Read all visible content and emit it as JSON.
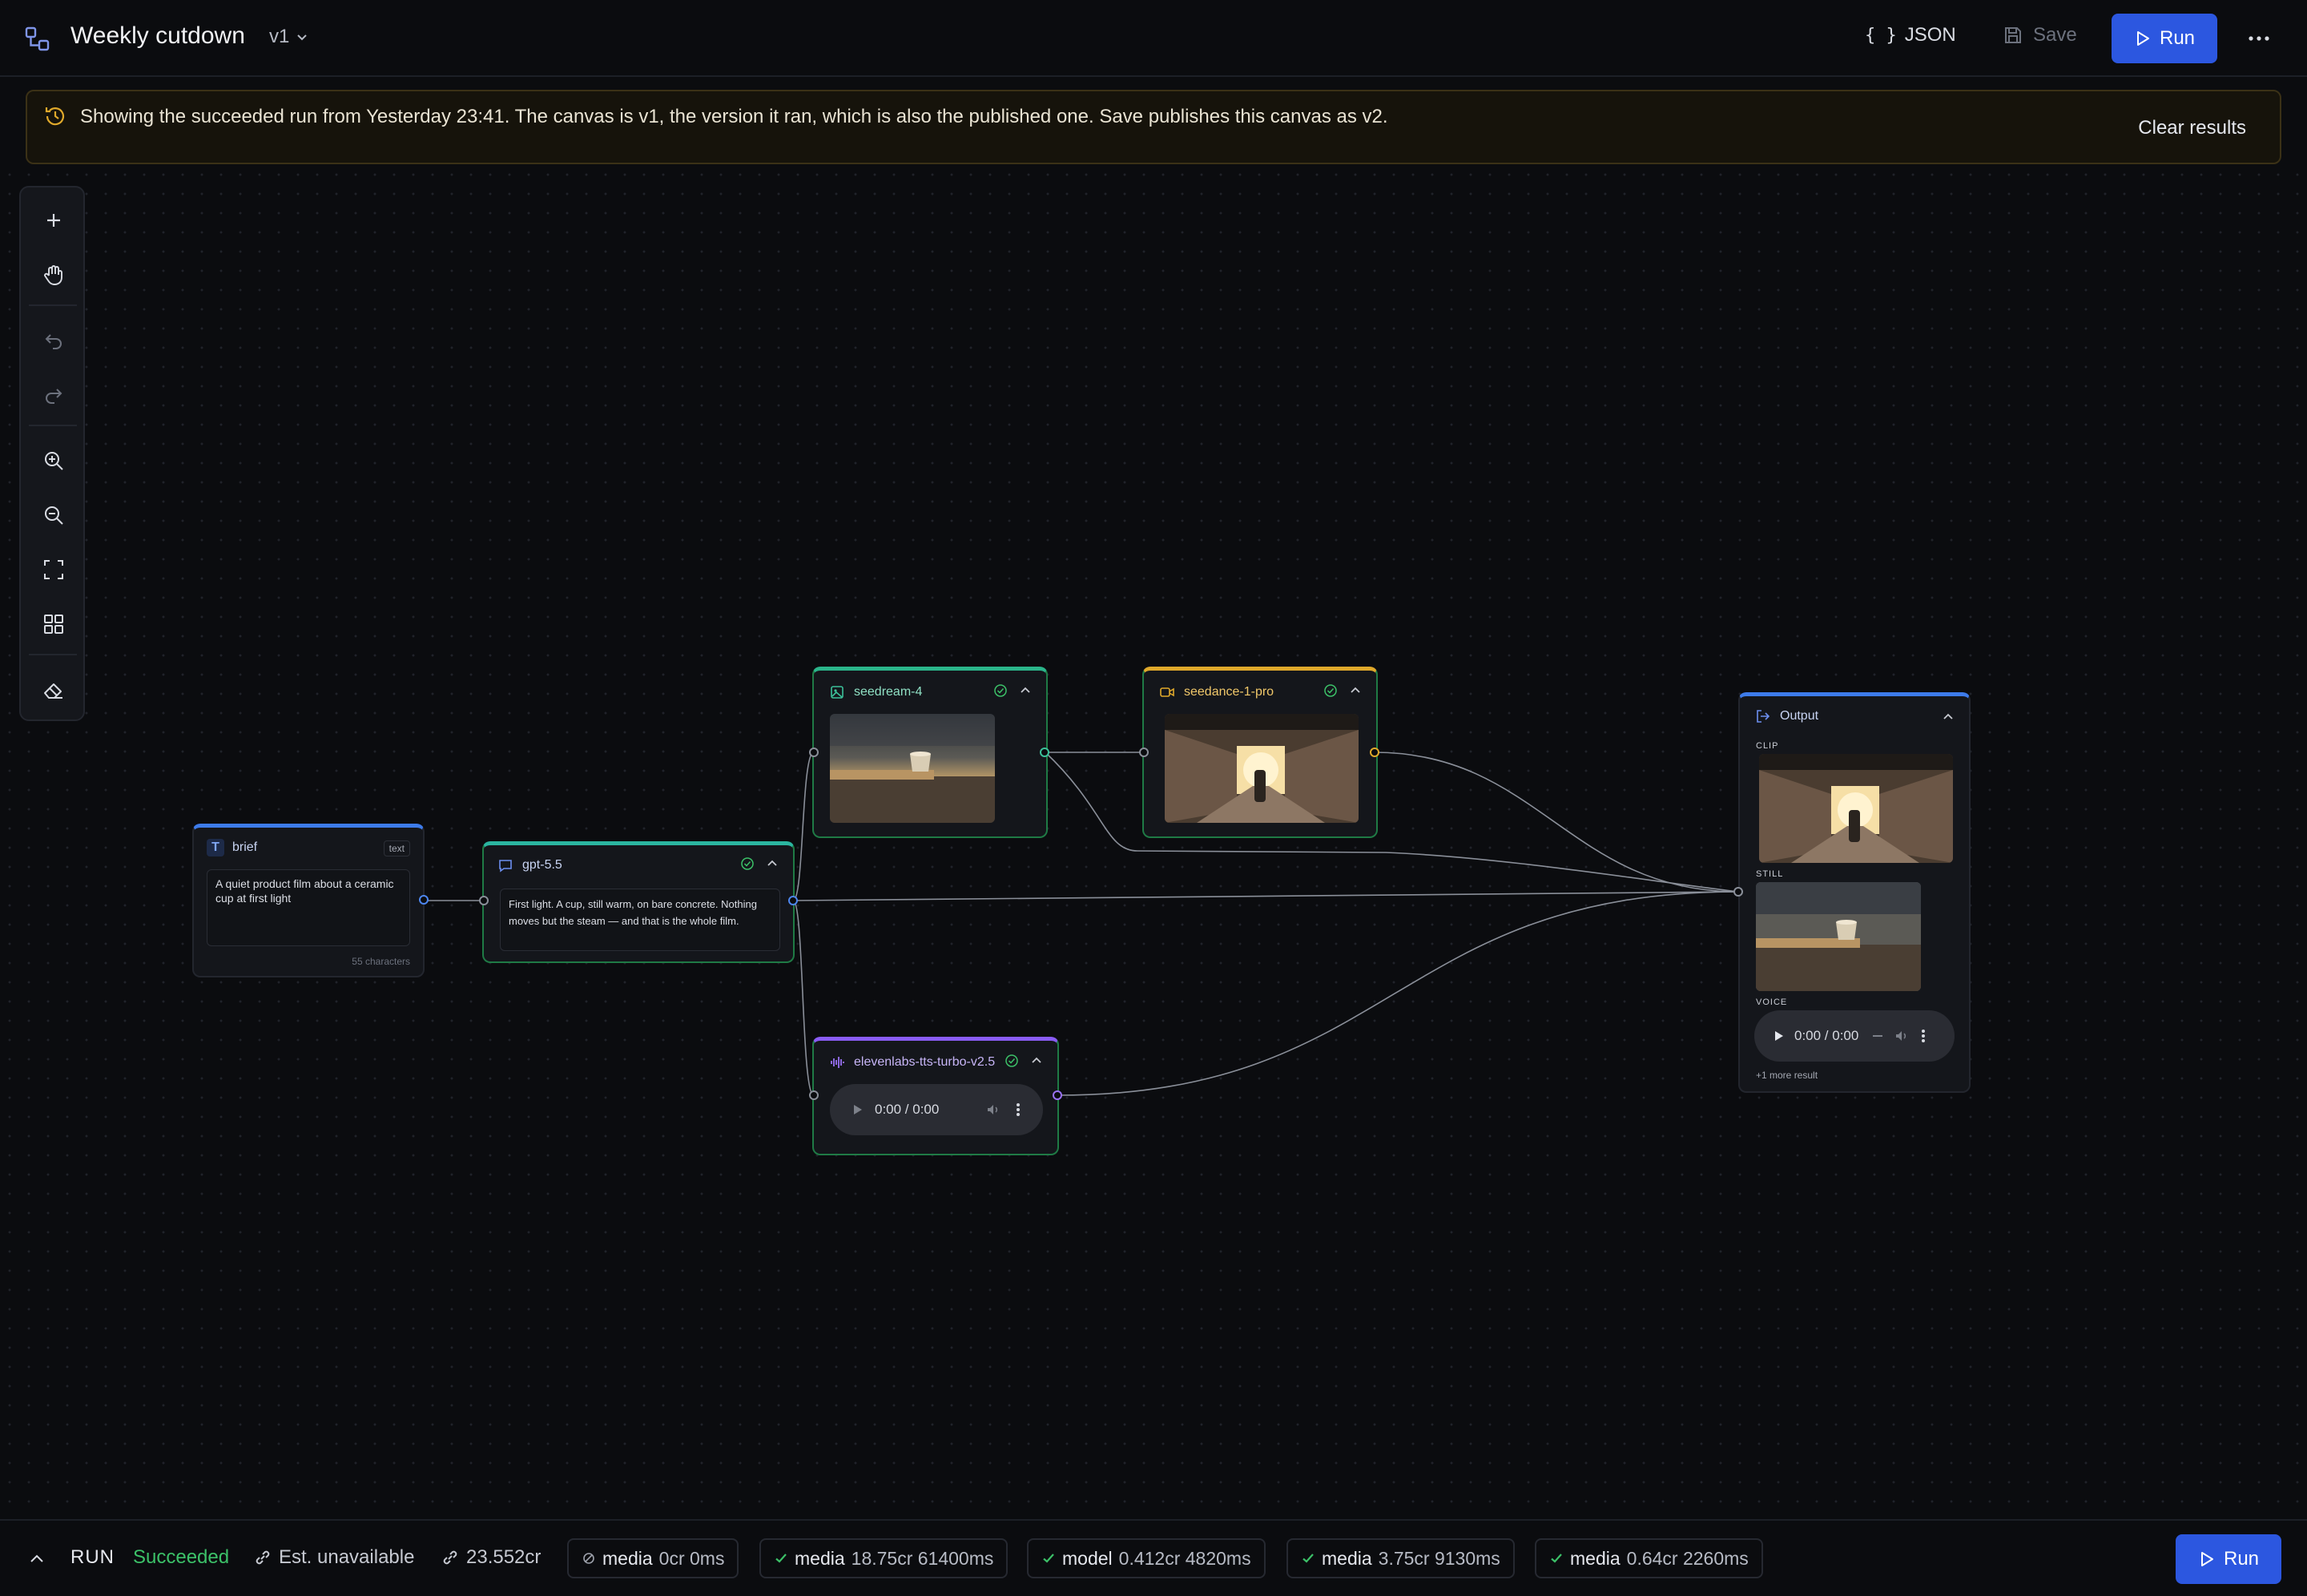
{
  "header": {
    "title": "Weekly cutdown",
    "version": "v1",
    "json_label": "JSON",
    "save_label": "Save",
    "run_label": "Run"
  },
  "banner": {
    "message": "Showing the succeeded run from Yesterday 23:41. The canvas is v1, the version it ran, which is also the published one. Save publishes this canvas as v2.",
    "clear_label": "Clear results"
  },
  "nodes": {
    "brief": {
      "title": "brief",
      "badge": "text",
      "content": "A quiet product film about a ceramic cup at first light",
      "count": "55 characters"
    },
    "gpt": {
      "title": "gpt-5.5",
      "content": "First light. A cup, still warm, on bare concrete. Nothing moves but the steam — and that is the whole film."
    },
    "seedream": {
      "title": "seedream-4"
    },
    "seedance": {
      "title": "seedance-1-pro"
    },
    "tts": {
      "title": "elevenlabs-tts-turbo-v2.5",
      "time": "0:00 / 0:00"
    },
    "output": {
      "title": "Output",
      "clip_label": "CLIP",
      "still_label": "STILL",
      "voice_label": "VOICE",
      "voice_time": "0:00 / 0:00",
      "more": "+1 more result"
    }
  },
  "status": {
    "run_label": "RUN",
    "state": "Succeeded",
    "estimate": "Est. unavailable",
    "total_cost": "23.552cr",
    "chips": [
      {
        "kind": "media",
        "meta": "0cr 0ms",
        "status": "skipped"
      },
      {
        "kind": "media",
        "meta": "18.75cr 61400ms",
        "status": "ok"
      },
      {
        "kind": "model",
        "meta": "0.412cr 4820ms",
        "status": "ok"
      },
      {
        "kind": "media",
        "meta": "3.75cr 9130ms",
        "status": "ok"
      },
      {
        "kind": "media",
        "meta": "0.64cr 2260ms",
        "status": "ok"
      }
    ],
    "run_button": "Run"
  },
  "colors": {
    "accent": "#2c57e0",
    "success": "#3cc168",
    "node_border_ok": "#1f7a45",
    "warn": "#e0a92b",
    "purple": "#8a5cf5",
    "blue": "#3d7bea",
    "teal": "#2bb5a0"
  }
}
